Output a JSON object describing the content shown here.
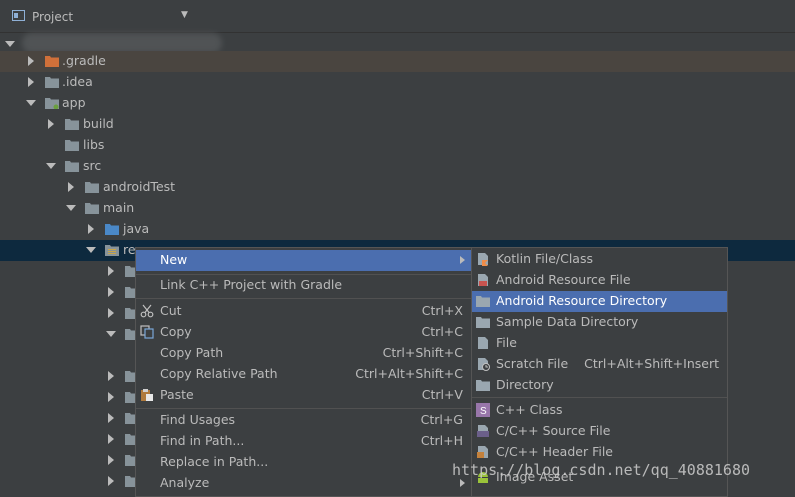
{
  "header": {
    "title": "Project"
  },
  "tree": [
    {
      "label": ".gradle",
      "depth": 1,
      "expanded": false
    },
    {
      "label": ".idea",
      "depth": 1,
      "expanded": false
    },
    {
      "label": "app",
      "depth": 1,
      "expanded": true
    },
    {
      "label": "build",
      "depth": 2,
      "expanded": false
    },
    {
      "label": "libs",
      "depth": 2,
      "expanded": null
    },
    {
      "label": "src",
      "depth": 2,
      "expanded": true
    },
    {
      "label": "androidTest",
      "depth": 3,
      "expanded": false
    },
    {
      "label": "main",
      "depth": 3,
      "expanded": true
    },
    {
      "label": "java",
      "depth": 4,
      "expanded": false
    },
    {
      "label": "re",
      "depth": 4,
      "expanded": true
    }
  ],
  "context_menu": {
    "items": [
      {
        "label": "New",
        "shortcut": "",
        "submenu": true,
        "active": true,
        "icon": ""
      },
      {
        "label": "Link C++ Project with Gradle",
        "shortcut": "",
        "icon": ""
      },
      {
        "label": "Cut",
        "shortcut": "Ctrl+X",
        "icon": "scissors-icon"
      },
      {
        "label": "Copy",
        "shortcut": "Ctrl+C",
        "icon": "copy-icon"
      },
      {
        "label": "Copy Path",
        "shortcut": "Ctrl+Shift+C",
        "icon": ""
      },
      {
        "label": "Copy Relative Path",
        "shortcut": "Ctrl+Alt+Shift+C",
        "icon": ""
      },
      {
        "label": "Paste",
        "shortcut": "Ctrl+V",
        "icon": "paste-icon"
      },
      {
        "label": "Find Usages",
        "shortcut": "Ctrl+G",
        "icon": ""
      },
      {
        "label": "Find in Path...",
        "shortcut": "Ctrl+H",
        "icon": ""
      },
      {
        "label": "Replace in Path...",
        "shortcut": "",
        "icon": ""
      },
      {
        "label": "Analyze",
        "shortcut": "",
        "submenu": true,
        "icon": ""
      }
    ]
  },
  "new_submenu": {
    "items": [
      {
        "label": "Kotlin File/Class",
        "shortcut": "",
        "icon": "kotlin-file-icon"
      },
      {
        "label": "Android Resource File",
        "shortcut": "",
        "icon": "android-resource-file-icon"
      },
      {
        "label": "Android Resource Directory",
        "shortcut": "",
        "icon": "folder-icon",
        "active": true
      },
      {
        "label": "Sample Data Directory",
        "shortcut": "",
        "icon": "folder-icon"
      },
      {
        "label": "File",
        "shortcut": "",
        "icon": "file-icon"
      },
      {
        "label": "Scratch File",
        "shortcut": "Ctrl+Alt+Shift+Insert",
        "icon": "scratch-file-icon"
      },
      {
        "label": "Directory",
        "shortcut": "",
        "icon": "folder-icon"
      },
      {
        "label": "C++ Class",
        "shortcut": "",
        "icon": "cpp-class-icon"
      },
      {
        "label": "C/C++ Source File",
        "shortcut": "",
        "icon": "cpp-source-icon"
      },
      {
        "label": "C/C++ Header File",
        "shortcut": "",
        "icon": "cpp-header-icon"
      },
      {
        "label": "Image Asset",
        "shortcut": "",
        "icon": "android-icon"
      }
    ]
  },
  "watermark": "https://blog.csdn.net/qq_40881680",
  "colors": {
    "background": "#3c3f41",
    "selection": "#4b6eaf",
    "tree_selected": "#0d293e",
    "folder": "#87939a",
    "folder_blue": "#4a88c7",
    "gradle_folder": "#d0703a"
  }
}
